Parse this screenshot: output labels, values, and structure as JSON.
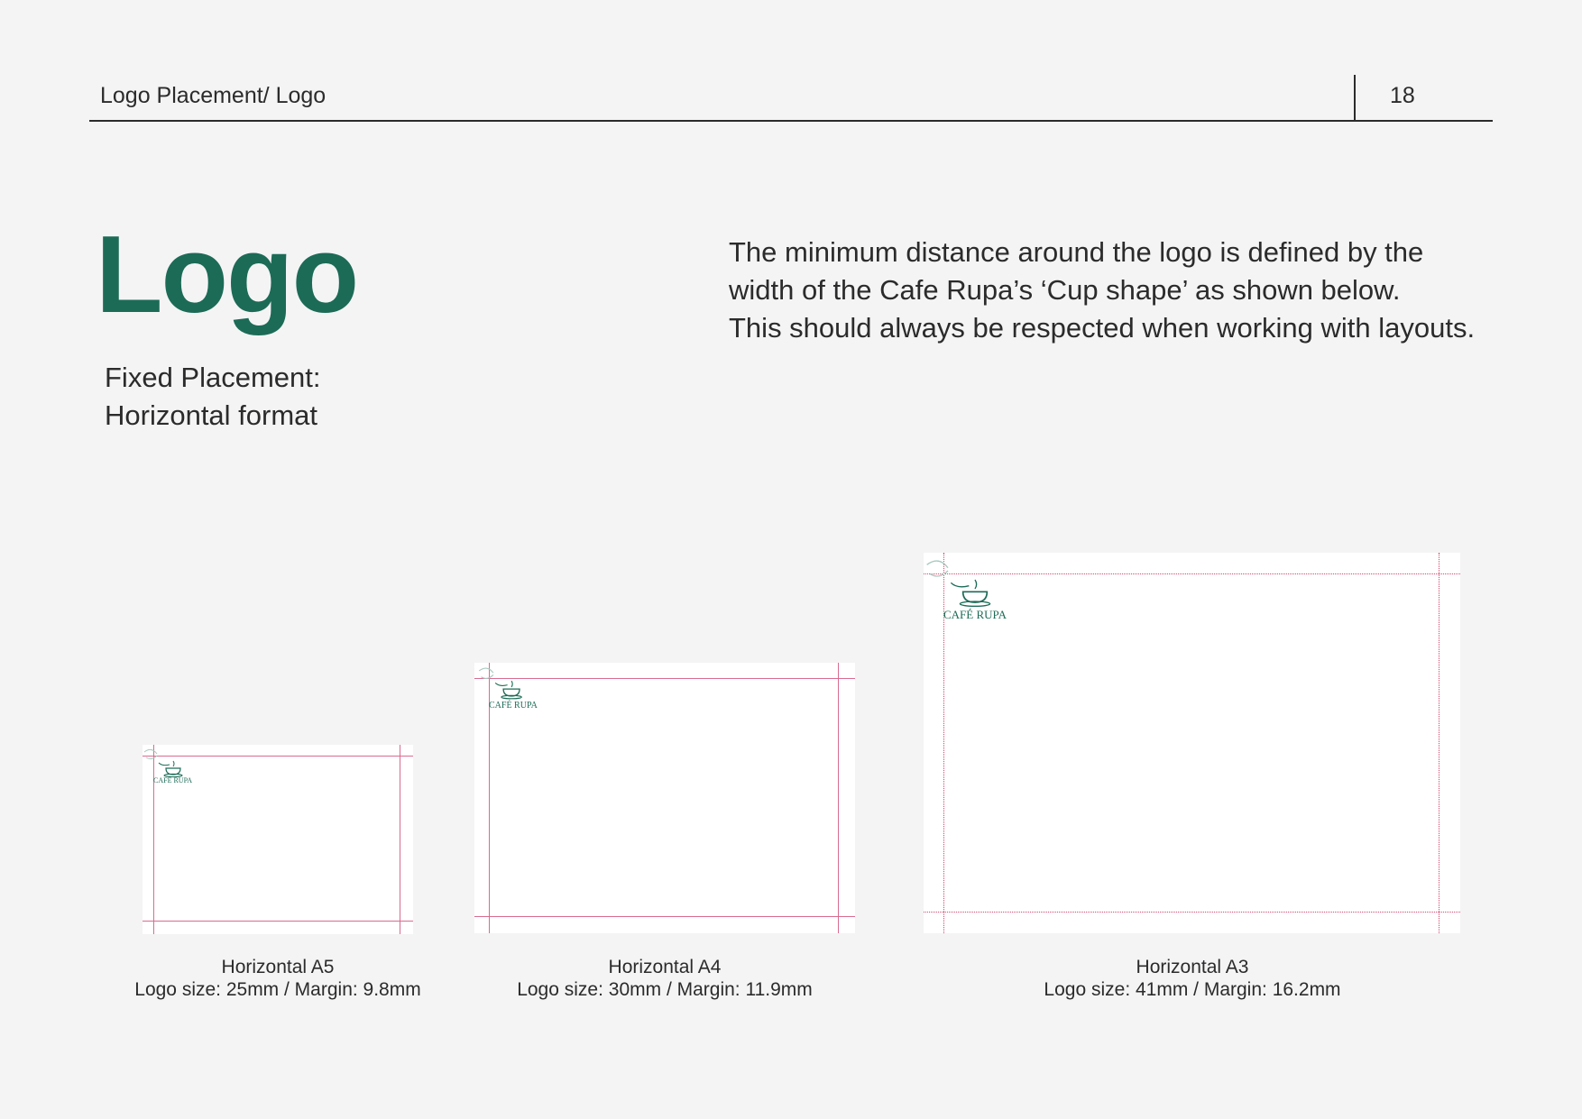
{
  "header": {
    "section": "Logo Placement/ Logo",
    "page_number": "18"
  },
  "title": "Logo",
  "subtitle": [
    "Fixed Placement:",
    "Horizontal format"
  ],
  "description": [
    "The minimum distance around the logo is defined by the",
    "width of the Cafe Rupa’s ‘Cup shape’ as shown below.",
    "This should always be respected when working with layouts."
  ],
  "brand": {
    "logo_wordmark": "CAFÉ RUPA",
    "primary_color": "#1c6b56",
    "guide_color": "#d96b8f"
  },
  "formats": [
    {
      "name": "Horizontal A5",
      "spec": "Logo size: 25mm / Margin: 9.8mm"
    },
    {
      "name": "Horizontal A4",
      "spec": "Logo size: 30mm / Margin: 11.9mm"
    },
    {
      "name": "Horizontal A3",
      "spec": "Logo size: 41mm / Margin: 16.2mm"
    }
  ]
}
